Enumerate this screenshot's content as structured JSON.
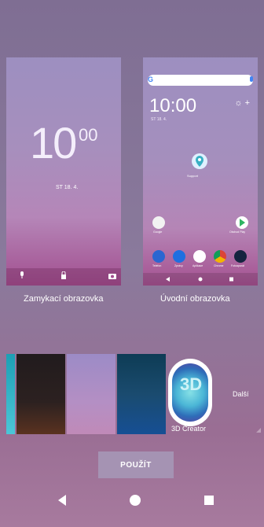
{
  "lock_preview": {
    "time_hour": "10",
    "time_min": "00",
    "date": "ST 18. 4.",
    "caption": "Zamykací obrazovka",
    "icons": [
      "microphone-icon",
      "lock-icon",
      "camera-icon"
    ]
  },
  "home_preview": {
    "search_logo": "G",
    "time": "10:00",
    "date": "ST 18. 4.",
    "caption": "Úvodní obrazovka",
    "pin_label": "Support",
    "apps_row1": [
      {
        "label": "Google",
        "color": "#f2f2f2"
      },
      {
        "label": "Obchod Play",
        "color": "#ffffff"
      }
    ],
    "apps_row2": [
      {
        "label": "Telefon",
        "color": "#2b66d1"
      },
      {
        "label": "Zprávy",
        "color": "#1f6fe0"
      },
      {
        "label": "Aplikace",
        "color": "#ffffff"
      },
      {
        "label": "Chrome",
        "color": "#dc4437"
      },
      {
        "label": "Fotoaparát",
        "color": "#14243f"
      }
    ]
  },
  "wallpapers": {
    "creator_label": "3D Creator",
    "creator_glyph": "3D",
    "more_label": "Další",
    "thumb_colors": [
      "#37b4c9",
      "#2b201f",
      "#b08fc4",
      "#1a4b6f"
    ]
  },
  "apply_button": "POUŽÍT",
  "navbar": {
    "icons": [
      "back-icon",
      "home-icon",
      "recents-icon"
    ]
  }
}
